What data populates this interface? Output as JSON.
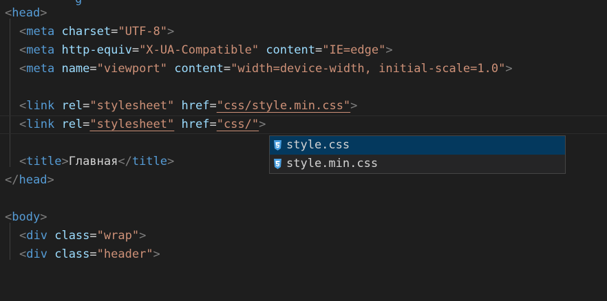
{
  "editor": {
    "top_partial": "g",
    "head_open": "head",
    "meta1": {
      "tag": "meta",
      "attr": "charset",
      "value": "\"UTF-8\""
    },
    "meta2": {
      "tag": "meta",
      "attr1": "http-equiv",
      "value1": "\"X-UA-Compatible\"",
      "attr2": "content",
      "value2": "\"IE=edge\""
    },
    "meta3": {
      "tag": "meta",
      "attr1": "name",
      "value1": "\"viewport\"",
      "attr2": "content",
      "value2": "\"width=device-width, initial-scale=1.0\""
    },
    "link1": {
      "tag": "link",
      "attr1": "rel",
      "value1": "\"stylesheet\"",
      "attr2": "href",
      "value2": "\"css/style.min.css\""
    },
    "link2": {
      "tag": "link",
      "attr1": "rel",
      "value1": "\"stylesheet\"",
      "attr2": "href",
      "value2": "\"css/\""
    },
    "title": {
      "tag": "title",
      "text": "Главная"
    },
    "head_close": "head",
    "body_open": "body",
    "div1": {
      "tag": "div",
      "attr": "class",
      "value": "\"wrap\""
    },
    "div2": {
      "tag": "div",
      "attr": "class",
      "value": "\"header\""
    }
  },
  "suggestions": [
    {
      "label": "style.css",
      "icon": "css-file-icon",
      "selected": true
    },
    {
      "label": "style.min.css",
      "icon": "css-file-icon",
      "selected": false
    }
  ],
  "colors": {
    "background": "#1e1e1e",
    "tag": "#569cd6",
    "attribute": "#9cdcfe",
    "string": "#ce9178",
    "punctuation": "#808080",
    "selection": "#04395e",
    "css_icon": "#4a9fe0"
  }
}
